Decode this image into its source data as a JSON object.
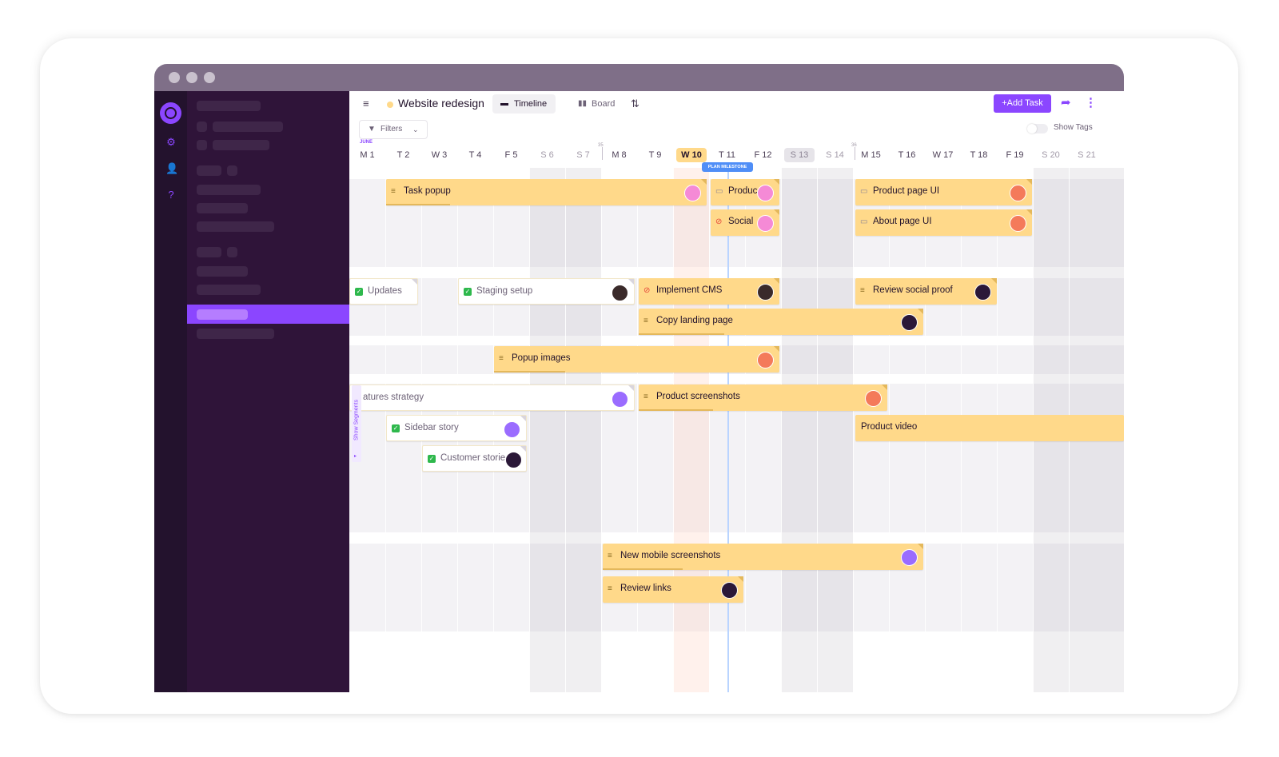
{
  "project": {
    "title": "Website redesign",
    "status_color": "#ffd98a"
  },
  "tabs": [
    {
      "label": "Timeline",
      "icon": "timeline-icon",
      "active": true
    },
    {
      "label": "Board",
      "icon": "board-icon",
      "active": false
    }
  ],
  "header": {
    "add_task_label": "+Add Task",
    "filters_label": "Filters",
    "show_tags_label": "Show Tags",
    "show_segments_label": "Show Segments",
    "milestone_label": "PLAN MILESTONE",
    "month_label": "JUNE",
    "week_numbers": [
      "35",
      "36"
    ]
  },
  "days": [
    "M 1",
    "T 2",
    "W 3",
    "T 4",
    "F 5",
    "S 6",
    "S 7",
    "M 8",
    "T 9",
    "W 10",
    "T 11",
    "F 12",
    "S 13",
    "S 14",
    "M 15",
    "T 16",
    "W 17",
    "T 18",
    "F 19",
    "S 20",
    "S 21"
  ],
  "tasks": [
    {
      "label": "Task popup",
      "icon": "bar-icon",
      "color": "yellow",
      "avatar": "#f58ad6",
      "progress": 0.2
    },
    {
      "label": "Product",
      "icon": "doc-icon",
      "color": "yellow",
      "avatar": "#f58ad6",
      "progress": 0
    },
    {
      "label": "Social",
      "icon": "ban-icon",
      "color": "yellow",
      "avatar": "#f58ad6",
      "progress": 0
    },
    {
      "label": "Product page UI",
      "icon": "doc-icon",
      "color": "yellow",
      "avatar": "#f47a5a",
      "progress": 0
    },
    {
      "label": "About page UI",
      "icon": "doc-icon",
      "color": "yellow",
      "avatar": "#f47a5a",
      "progress": 0
    },
    {
      "label": "Updates",
      "icon": "check-icon",
      "color": "white",
      "avatar": "",
      "progress": 0
    },
    {
      "label": "Staging setup",
      "icon": "check-icon",
      "color": "white",
      "avatar": "#3a2a2a",
      "progress": 0
    },
    {
      "label": "Implement CMS",
      "icon": "ban-icon",
      "color": "yellow",
      "avatar": "#3a2a2a",
      "progress": 0
    },
    {
      "label": "Review social proof",
      "icon": "bar-icon",
      "color": "yellow",
      "avatar": "#2b1838",
      "progress": 0
    },
    {
      "label": "Copy landing page",
      "icon": "bar-icon",
      "color": "yellow",
      "avatar": "#2b1838",
      "progress": 0.3
    },
    {
      "label": "Popup images",
      "icon": "bar-icon",
      "color": "yellow",
      "avatar": "#f47a5a",
      "progress": 0.25
    },
    {
      "label": "atures strategy",
      "icon": "",
      "color": "white",
      "avatar": "#9a6cff",
      "progress": 0
    },
    {
      "label": "Product screenshots",
      "icon": "bar-icon",
      "color": "yellow",
      "avatar": "#f47a5a",
      "progress": 0.3
    },
    {
      "label": "Sidebar story",
      "icon": "check-icon",
      "color": "white",
      "avatar": "#9a6cff",
      "progress": 0
    },
    {
      "label": "Product video",
      "icon": "",
      "color": "yellow",
      "avatar": "",
      "progress": 0
    },
    {
      "label": "Customer storie",
      "icon": "check-icon",
      "color": "white",
      "avatar": "#2b1838",
      "progress": 0
    },
    {
      "label": "New mobile screenshots",
      "icon": "bar-icon",
      "color": "yellow",
      "avatar": "#9a6cff",
      "progress": 0.25
    },
    {
      "label": "Review links",
      "icon": "bar-icon",
      "color": "yellow",
      "avatar": "#2b1838",
      "progress": 0
    }
  ],
  "colors": {
    "accent": "#8b46ff",
    "task": "#ffd98a",
    "sidebar": "#2f1439",
    "rail": "#23122d",
    "milestone": "#4f8ef7"
  }
}
